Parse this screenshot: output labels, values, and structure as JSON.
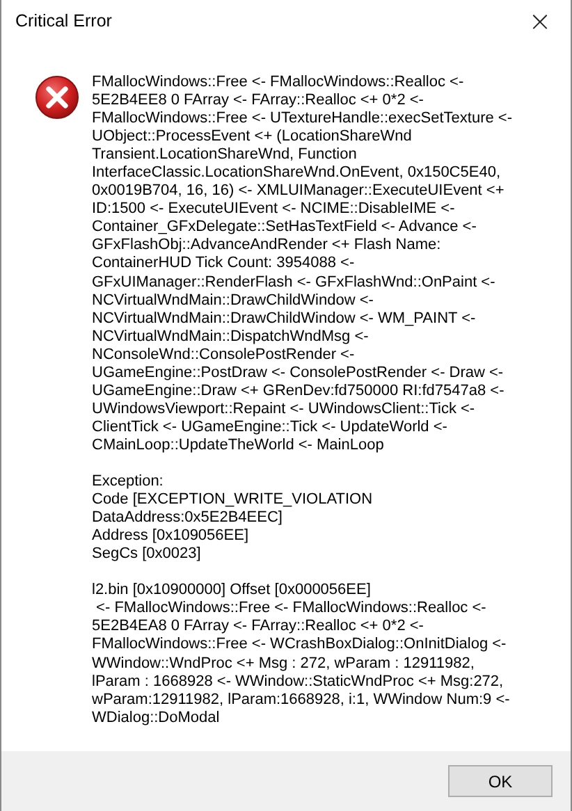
{
  "window": {
    "title": "Critical Error",
    "close": "×"
  },
  "message": [
    [
      "FMallocWindows::Free <- FMallocWindows::Realloc <-",
      "5E2B4EE8 0 FArray <- FArray::Realloc <+ 0*2 <-",
      "FMallocWindows::Free <- UTextureHandle::execSetTexture <-",
      "UObject::ProcessEvent <+ (LocationShareWnd",
      "Transient.LocationShareWnd, Function",
      "InterfaceClassic.LocationShareWnd.OnEvent, 0x150C5E40,",
      "0x0019B704, 16, 16) <- XMLUIManager::ExecuteUIEvent <+",
      "ID:1500 <- ExecuteUIEvent <- NCIME::DisableIME <-",
      "Container_GFxDelegate::SetHasTextField <- Advance <-",
      "GFxFlashObj::AdvanceAndRender <+ Flash Name:",
      "ContainerHUD Tick Count: 3954088 <-",
      "GFxUIManager::RenderFlash <- GFxFlashWnd::OnPaint <-",
      "NCVirtualWndMain::DrawChildWindow <-",
      "NCVirtualWndMain::DrawChildWindow <- WM_PAINT <-",
      "NCVirtualWndMain::DispatchWndMsg <-",
      "NConsoleWnd::ConsolePostRender <-",
      "UGameEngine::PostDraw <- ConsolePostRender <- Draw <-",
      "UGameEngine::Draw <+ GRenDev:fd750000 RI:fd7547a8 <-",
      "UWindowsViewport::Repaint <- UWindowsClient::Tick <-",
      "ClientTick <- UGameEngine::Tick <- UpdateWorld <-",
      "CMainLoop::UpdateTheWorld <- MainLoop"
    ],
    [
      "Exception:",
      "Code [EXCEPTION_WRITE_VIOLATION",
      "DataAddress:0x5E2B4EEC]",
      "Address [0x109056EE]",
      "SegCs [0x0023]"
    ],
    [
      "l2.bin [0x10900000] Offset [0x000056EE]",
      " <- FMallocWindows::Free <- FMallocWindows::Realloc <-",
      "5E2B4EA8 0 FArray <- FArray::Realloc <+ 0*2 <-",
      "FMallocWindows::Free <- WCrashBoxDialog::OnInitDialog <-",
      "WWindow::WndProc <+ Msg : 272, wParam : 12911982,",
      "lParam : 1668928 <- WWindow::StaticWndProc <+ Msg:272,",
      "wParam:12911982, lParam:1668928, i:1, WWindow Num:9 <-",
      "WDialog::DoModal"
    ]
  ],
  "buttons": [
    "OK"
  ]
}
